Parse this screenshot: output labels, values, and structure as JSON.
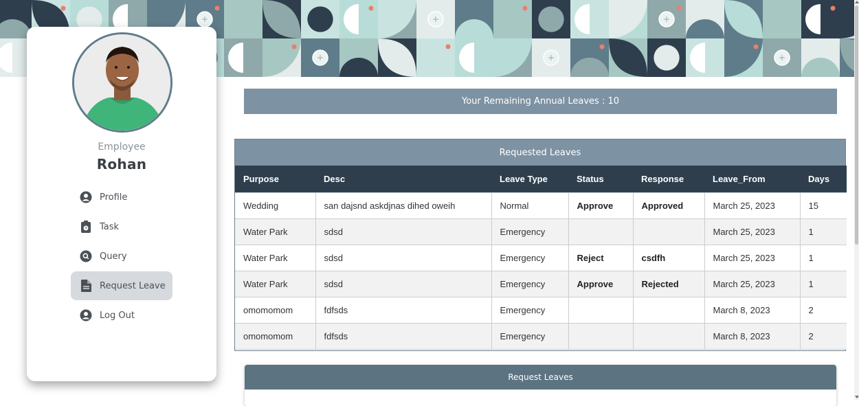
{
  "user": {
    "role": "Employee",
    "name": "Rohan"
  },
  "nav": [
    {
      "label": "Profile",
      "icon": "user-circle-icon"
    },
    {
      "label": "Task",
      "icon": "clipboard-icon"
    },
    {
      "label": "Query",
      "icon": "search-circle-icon"
    },
    {
      "label": "Request Leave",
      "icon": "document-icon",
      "active": true
    },
    {
      "label": "Log Out",
      "icon": "user-circle-icon"
    }
  ],
  "remaining_leaves": "Your Remaining Annual Leaves : 10",
  "requested_leaves": {
    "title": "Requested Leaves",
    "columns": [
      "Purpose",
      "Desc",
      "Leave Type",
      "Status",
      "Response",
      "Leave_From",
      "Days"
    ],
    "rows": [
      [
        "Wedding",
        "san dajsnd askdjnas dihed oweih",
        "Normal",
        "Approve",
        "Approved",
        "March 25, 2023",
        "15"
      ],
      [
        "Water Park",
        "sdsd",
        "Emergency",
        "",
        "",
        "March 25, 2023",
        "1"
      ],
      [
        "Water Park",
        "sdsd",
        "Emergency",
        "Reject",
        "csdfh",
        "March 25, 2023",
        "1"
      ],
      [
        "Water Park",
        "sdsd",
        "Emergency",
        "Approve",
        "Rejected",
        "March 25, 2023",
        "1"
      ],
      [
        "omomomom",
        "fdfsds",
        "Emergency",
        "",
        "",
        "March 8, 2023",
        "2"
      ],
      [
        "omomomom",
        "fdfsds",
        "Emergency",
        "",
        "",
        "March 8, 2023",
        "2"
      ]
    ]
  },
  "request_form": {
    "title": "Request Leaves"
  },
  "colors": {
    "header_bar": "#7d92a3",
    "table_head": "#2e3e4d",
    "panel_head": "#5c7381",
    "active_nav": "#d6dade"
  }
}
